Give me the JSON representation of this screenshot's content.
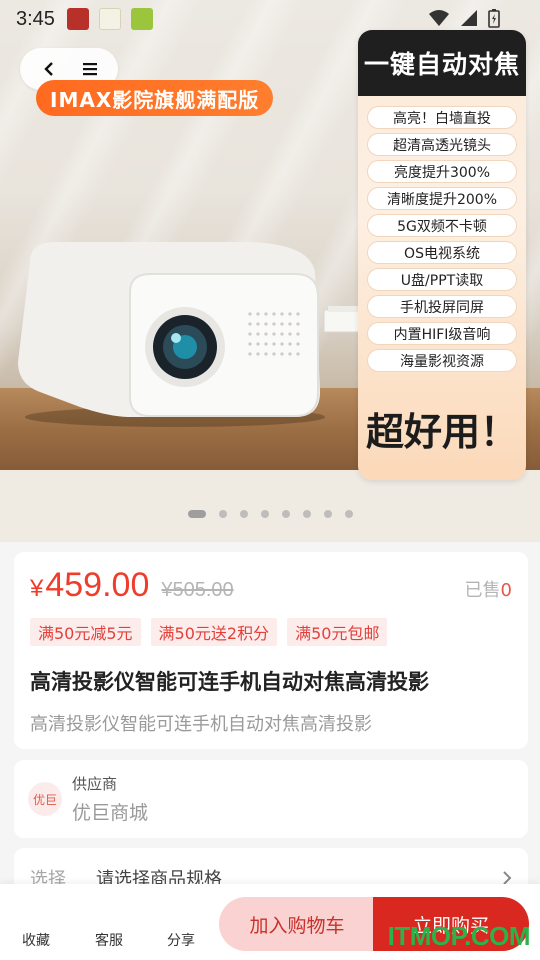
{
  "status_bar": {
    "time": "3:45"
  },
  "hero": {
    "tag": "IMAX影院旗舰满配版",
    "panel_title": "一键自动对焦",
    "features": [
      "高亮！白墙直投",
      "超清高透光镜头",
      "亮度提升300%",
      "清晰度提升200%",
      "5G双频不卡顿",
      "OS电视系统",
      "U盘/PPT读取",
      "手机投屏同屏",
      "内置HIFI级音响",
      "海量影视资源"
    ],
    "panel_footer": "超好用！",
    "slides_total": 8,
    "slide_active": 1
  },
  "price": {
    "symbol": "¥",
    "current": "459.00",
    "original": "¥505.00",
    "sold_label": "已售",
    "sold_count": "0",
    "promos": [
      "满50元减5元",
      "满50元送2积分",
      "满50元包邮"
    ]
  },
  "product": {
    "title": "高清投影仪智能可连手机自动对焦高清投影",
    "subtitle": "高清投影仪智能可连手机自动对焦高清投影"
  },
  "supplier": {
    "avatar_text": "优巨",
    "label": "供应商",
    "name": "优巨商城"
  },
  "spec": {
    "label": "选择",
    "value": "请选择商品规格"
  },
  "bottom_bar": {
    "favorite": "收藏",
    "service": "客服",
    "share": "分享",
    "add_to_cart": "加入购物车",
    "buy_now": "立即购买"
  },
  "watermark": "ITMOP.COM",
  "colors": {
    "accent": "#f03c2a",
    "buy": "#d8281f",
    "cart": "#fbd2d2",
    "tag": "#ff6a1f"
  }
}
